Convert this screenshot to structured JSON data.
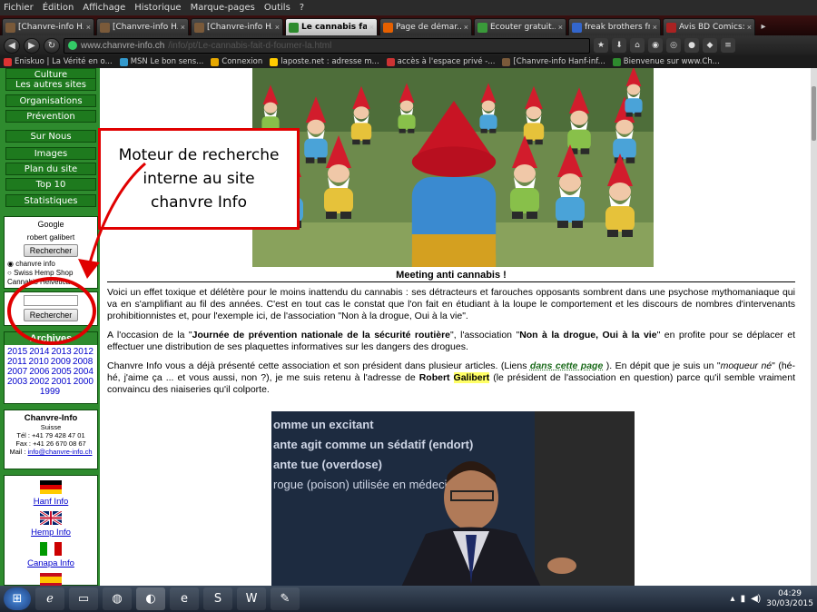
{
  "menubar": [
    "Fichier",
    "Édition",
    "Affichage",
    "Historique",
    "Marque-pages",
    "Outils",
    "?"
  ],
  "tabs": [
    {
      "label": "[Chanvre-info H...",
      "icon": "tw",
      "color": "#7a5a3a",
      "active": false
    },
    {
      "label": "[Chanvre-info H...",
      "icon": "tw",
      "color": "#7a5a3a",
      "active": false
    },
    {
      "label": "[Chanvre-info H...",
      "icon": "tw",
      "color": "#7a5a3a",
      "active": false
    },
    {
      "label": "Le cannabis fa...",
      "icon": "leaf",
      "color": "#2e8b2e",
      "active": true
    },
    {
      "label": "Page de démar...",
      "icon": "firefox",
      "color": "#e66000",
      "active": false
    },
    {
      "label": "Écouter gratuit...",
      "icon": "music",
      "color": "#3a9a3a",
      "active": false
    },
    {
      "label": "freak brothers frenc...",
      "icon": "google",
      "color": "#3366cc",
      "active": false
    },
    {
      "label": "Avis BD Comics:...",
      "icon": "bd",
      "color": "#aa2222",
      "active": false
    }
  ],
  "url": {
    "host": "www.chanvre-info.ch",
    "path": "/info/pt/Le-cannabis-fait-d-foumer-la.html"
  },
  "bookmarks": [
    {
      "label": "Eniskuo | La Vérité en o...",
      "color": "#d33"
    },
    {
      "label": "MSN Le bon sens...",
      "color": "#39c"
    },
    {
      "label": "Connexion",
      "color": "#e6a800"
    },
    {
      "label": "laposte.net : adresse m...",
      "color": "#fc0"
    },
    {
      "label": "accès à l'espace privé -...",
      "color": "#c33"
    },
    {
      "label": "[Chanvre-info Hanf-inf...",
      "color": "#7a5a3a"
    },
    {
      "label": "Bienvenue sur www.Ch...",
      "color": "#2e8b2e"
    }
  ],
  "sidebar": {
    "nav": [
      "Culture",
      "Les autres sites",
      "Organisations",
      "Prévention",
      "Sur Nous",
      "Images",
      "Plan du site",
      "Top 10",
      "Statistiques"
    ],
    "google": {
      "title": "Google",
      "query": "robert galibert",
      "button": "Rechercher",
      "options": [
        "chanvre info",
        "Swiss Hemp Shop",
        "Cannabis Helvetica"
      ]
    },
    "search_button": "Rechercher",
    "archives": {
      "title": "Archives",
      "years": [
        "2015",
        "2014",
        "2013",
        "2012",
        "2011",
        "2010",
        "2009",
        "2008",
        "2007",
        "2006",
        "2005",
        "2004",
        "2003",
        "2002",
        "2001",
        "2000",
        "1999"
      ]
    },
    "contact": {
      "title": "Chanvre-Info",
      "country": "Suisse",
      "tel": "Tél : +41 79 428 47 01",
      "fax": "Fax : +41 26 670 08 67",
      "mail_label": "Mail :",
      "mail": "info@chanvre-info.ch"
    },
    "languages": [
      "Hanf Info",
      "Hemp Info",
      "Canapa Info"
    ]
  },
  "callout": {
    "line1": "Moteur de recherche",
    "line2": "interne au site",
    "line3": "chanvre Info"
  },
  "article": {
    "caption": "Meeting anti cannabis !",
    "p1": "Voici un effet toxique et délétère pour le moins inattendu du cannabis : ses détracteurs et farouches opposants sombrent dans une psychose mythomaniaque qui va en s'amplifiant au fil des années. C'est en tout cas le constat que l'on fait en étudiant à la loupe le comportement et les discours de nombres d'intervenants prohibitionnistes et, pour l'exemple ici, de l'association \"Non à la drogue, Oui à la vie\".",
    "p2a": "A l'occasion de la \"",
    "p2b": "Journée de prévention nationale de la sécurité routière",
    "p2c": "\", l'association \"",
    "p2d": "Non à la drogue, Oui à la vie",
    "p2e": "\" en profite pour se déplacer et effectuer une distribution de ses plaquettes informatives sur les dangers des drogues.",
    "p3a": "Chanvre Info vous a déjà présenté cette association et son président dans plusieur articles. (Liens ",
    "p3b": "dans cette page",
    "p3c": " ). En dépit que je suis un \"",
    "p3d": "moqueur né",
    "p3e": "\" (hé-hé, j'aime ça ... et vous aussi, non ?), je me suis retenu à l'adresse de ",
    "p3f": "Robert ",
    "p3g": "Galibert",
    "p3h": " (le président de l'association en question) parce qu'il semble vraiment convaincu des niaiseries qu'il colporte.",
    "slide_lines": [
      "omme un excitant",
      "ante agit comme un sédatif (endort)",
      "ante tue (overdose)",
      "rogue (poison) utilisée en médecine"
    ]
  },
  "taskbar": {
    "time": "04:29",
    "date": "30/03/2015"
  }
}
